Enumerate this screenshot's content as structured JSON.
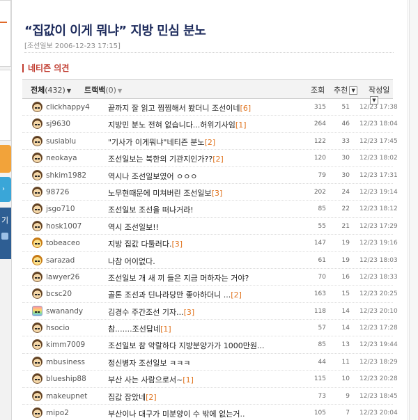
{
  "left_panel": {
    "blue_label": "›",
    "navy_label": "기"
  },
  "article": {
    "title": "“집값이 이게 뭐냐” 지방 민심 분노",
    "byline": "[조선일보 2006-12-23 17:15]"
  },
  "comments": {
    "section_title": "네티즌 의견",
    "tabs": [
      {
        "label": "전체",
        "count": "(432)"
      },
      {
        "label": "트랙백",
        "count": "(0)"
      }
    ],
    "columns": {
      "views": "조회",
      "recommend": "추천",
      "date": "작성일"
    },
    "rows": [
      {
        "nick": "clickhappy4",
        "subject": "끝까지 잘 읽고 찜찜해서 봤더니 조선이네",
        "rc": "[6]",
        "views": "315",
        "rec": "51",
        "date": "12/23 17:38",
        "avatar": ""
      },
      {
        "nick": "sj9630",
        "subject": "지방민 분노 전혀 없습니다...허위기사임",
        "rc": "[1]",
        "views": "264",
        "rec": "46",
        "date": "12/23 18:04",
        "avatar": ""
      },
      {
        "nick": "susiablu",
        "subject": "\"기사가 이게뭐냐\"네티즌 분노",
        "rc": "[2]",
        "views": "122",
        "rec": "33",
        "date": "12/23 17:45",
        "avatar": ""
      },
      {
        "nick": "neokaya",
        "subject": "조선일보는 북한의 기관지인가??",
        "rc": "[2]",
        "views": "120",
        "rec": "30",
        "date": "12/23 18:02",
        "avatar": ""
      },
      {
        "nick": "shkim1982",
        "subject": "역시나 조선일보였어 ㅇㅇㅇ",
        "rc": "",
        "views": "79",
        "rec": "30",
        "date": "12/23 17:31",
        "avatar": ""
      },
      {
        "nick": "98726",
        "subject": "노무현때문에 미쳐버린 조선일보",
        "rc": "[3]",
        "views": "202",
        "rec": "24",
        "date": "12/23 19:14",
        "avatar": ""
      },
      {
        "nick": "jsgo710",
        "subject": "조선일보 조선을 떠나거라!",
        "rc": "",
        "views": "85",
        "rec": "22",
        "date": "12/23 18:12",
        "avatar": ""
      },
      {
        "nick": "hosk1007",
        "subject": "역시 조선일보!!",
        "rc": "",
        "views": "55",
        "rec": "21",
        "date": "12/23 17:29",
        "avatar": ""
      },
      {
        "nick": "tobeaceo",
        "subject": "지방 집값 다툴러다.",
        "rc": "[3]",
        "views": "147",
        "rec": "19",
        "date": "12/23 19:16",
        "avatar": "a"
      },
      {
        "nick": "sarazad",
        "subject": "나참 어이없다.",
        "rc": "",
        "views": "61",
        "rec": "19",
        "date": "12/23 18:03",
        "avatar": "a"
      },
      {
        "nick": "lawyer26",
        "subject": "조선일보 개 새 끼 들은 지금 머하자는 거야?",
        "rc": "",
        "views": "70",
        "rec": "16",
        "date": "12/23 18:33",
        "avatar": ""
      },
      {
        "nick": "bcsc20",
        "subject": "골톤 조선과 딘나라당만 좋아하더니 ...",
        "rc": "[2]",
        "views": "163",
        "rec": "15",
        "date": "12/23 20:25",
        "avatar": ""
      },
      {
        "nick": "swanandy",
        "subject": "김경수 주간조선 기자...",
        "rc": "[3]",
        "views": "118",
        "rec": "14",
        "date": "12/23 20:10",
        "avatar": "b"
      },
      {
        "nick": "hsocio",
        "subject": "참.......조선답네",
        "rc": "[1]",
        "views": "57",
        "rec": "14",
        "date": "12/23 17:28",
        "avatar": ""
      },
      {
        "nick": "kimm7009",
        "subject": "조선일보 참 악랄하다 지방분양가가 1000만원...",
        "rc": "",
        "views": "85",
        "rec": "13",
        "date": "12/23 19:44",
        "avatar": ""
      },
      {
        "nick": "mbusiness",
        "subject": "정신병자 조선일보 ㅋㅋㅋ",
        "rc": "",
        "views": "44",
        "rec": "11",
        "date": "12/23 18:29",
        "avatar": ""
      },
      {
        "nick": "blueship88",
        "subject": "부산 사는 사람으로서~",
        "rc": "[1]",
        "views": "115",
        "rec": "10",
        "date": "12/23 20:28",
        "avatar": ""
      },
      {
        "nick": "makeupnet",
        "subject": "집값 잡았네",
        "rc": "[2]",
        "views": "73",
        "rec": "9",
        "date": "12/23 18:45",
        "avatar": ""
      },
      {
        "nick": "mipo2",
        "subject": "부산이나 대구가 미분양이 수 밖에 없는거..",
        "rc": "",
        "views": "105",
        "rec": "7",
        "date": "12/23 20:04",
        "avatar": ""
      }
    ]
  }
}
